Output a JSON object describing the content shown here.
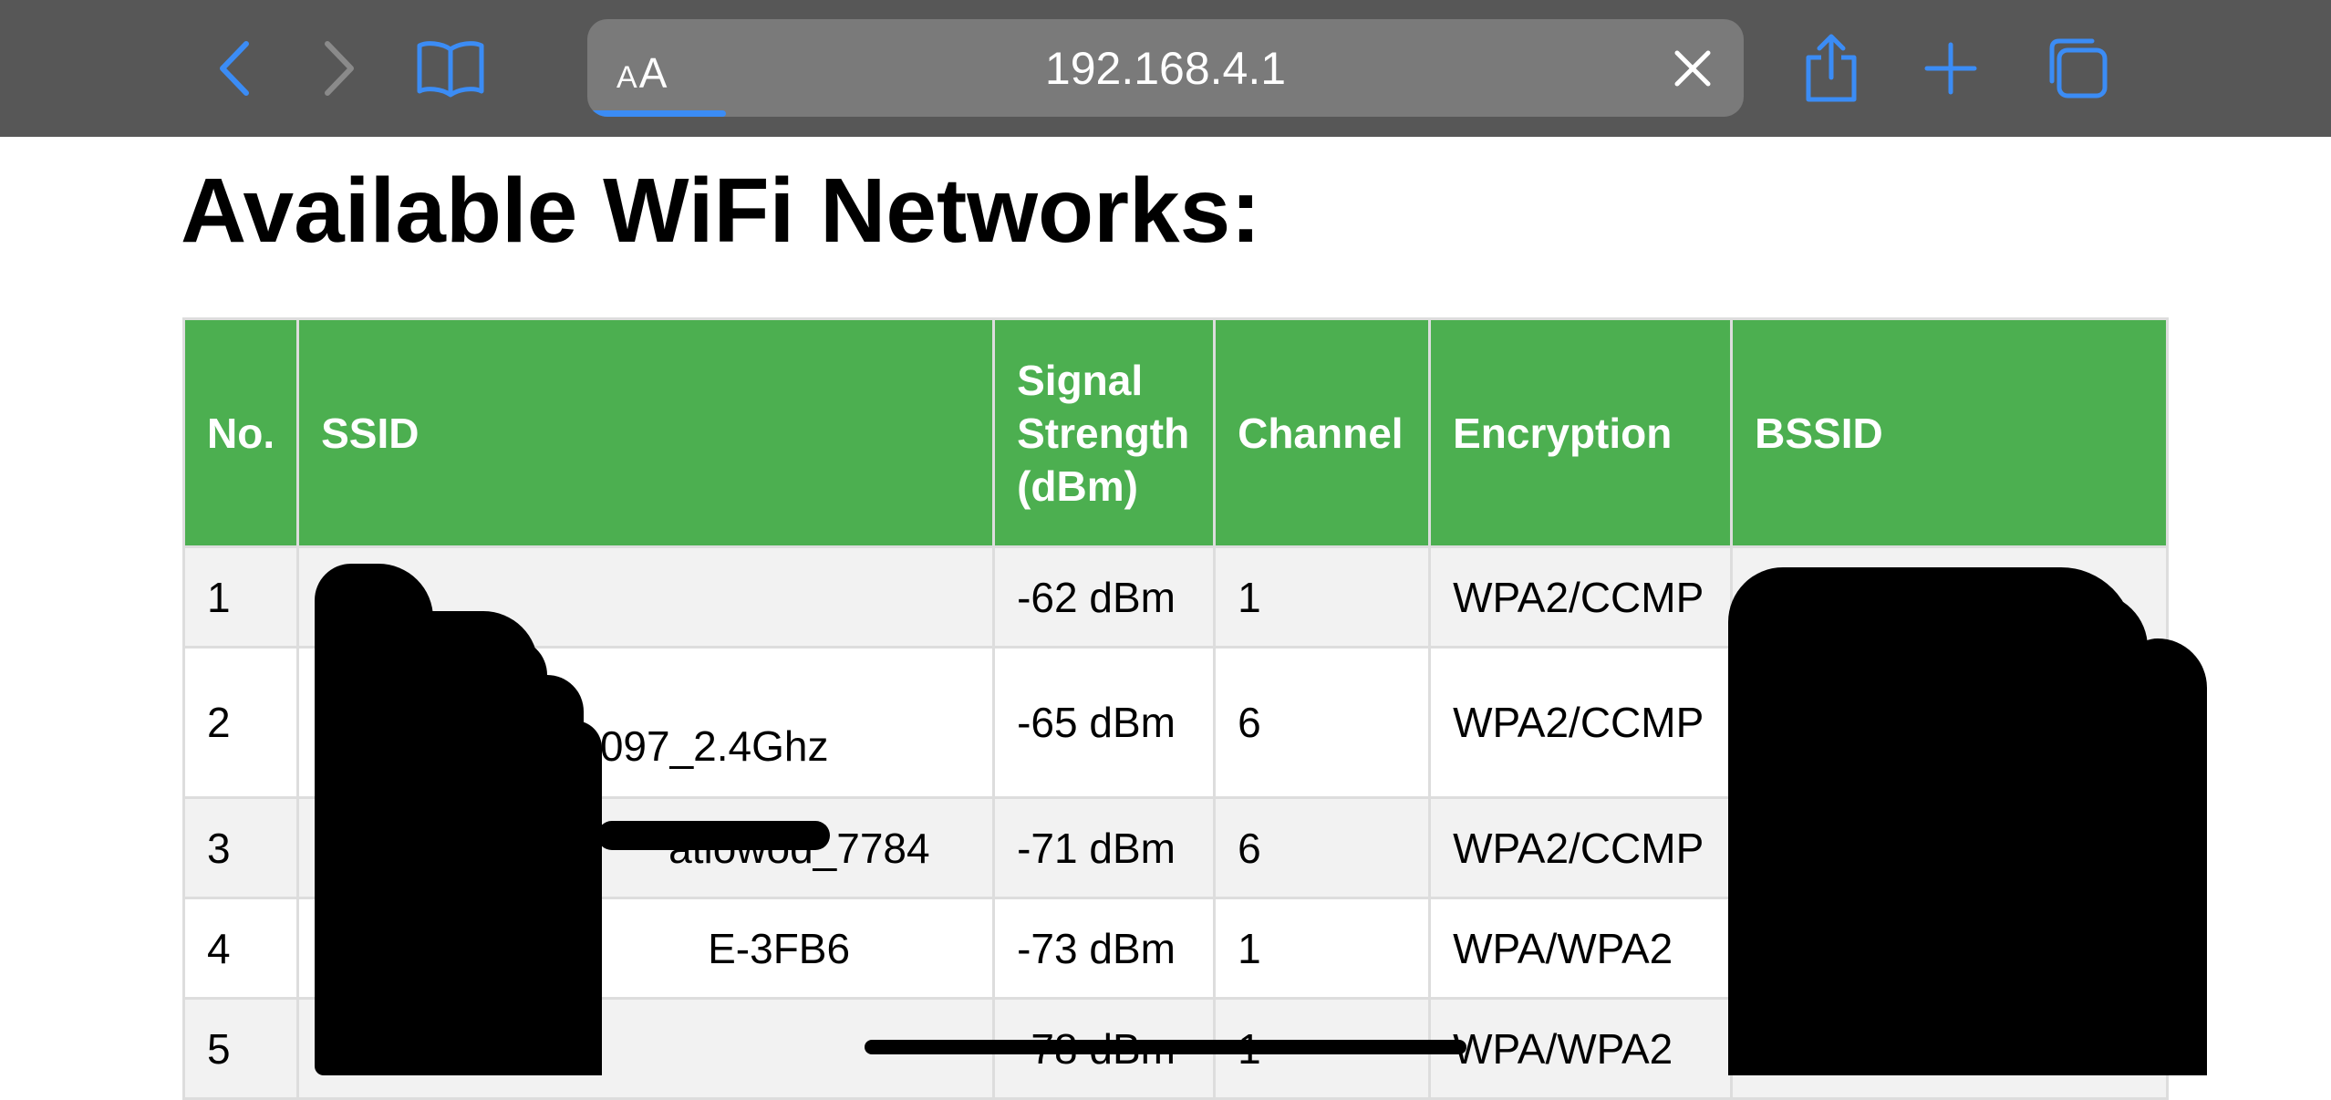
{
  "browser": {
    "address_text_size_small": "A",
    "address_text_size_big": "A",
    "url": "192.168.4.1",
    "load_progress": 0.12,
    "accent_color": "#3b8cf5",
    "toolbar_color": "#575757",
    "icons": {
      "back": "chevron-left-icon",
      "forward": "chevron-right-icon",
      "bookmarks": "book-icon",
      "clear": "close-icon",
      "share": "share-icon",
      "new_tab": "plus-icon",
      "tabs": "tabs-icon"
    }
  },
  "page": {
    "title": "Available WiFi Networks:"
  },
  "table": {
    "header_color": "#4caf50",
    "headers": [
      "No.",
      "SSID",
      "Signal Strength (dBm)",
      "Channel",
      "Encryption",
      "BSSID"
    ],
    "rows": [
      {
        "no": "1",
        "ssid": "",
        "signal": "-62 dBm",
        "channel": "1",
        "encryption": "WPA2/CCMP",
        "bssid": ""
      },
      {
        "no": "2",
        "ssid": "atlowod_2097_2.4Ghz",
        "signal": "-65 dBm",
        "channel": "6",
        "encryption": "WPA2/CCMP",
        "bssid": ""
      },
      {
        "no": "3",
        "ssid": "atlowod_7784",
        "signal": "-71 dBm",
        "channel": "6",
        "encryption": "WPA2/CCMP",
        "bssid": ""
      },
      {
        "no": "4",
        "ssid": "E-3FB6",
        "signal": "-73 dBm",
        "channel": "1",
        "encryption": "WPA/WPA2",
        "bssid": ""
      },
      {
        "no": "5",
        "ssid": "",
        "signal": "-78 dBm",
        "channel": "1",
        "encryption": "WPA/WPA2",
        "bssid": ""
      }
    ]
  }
}
